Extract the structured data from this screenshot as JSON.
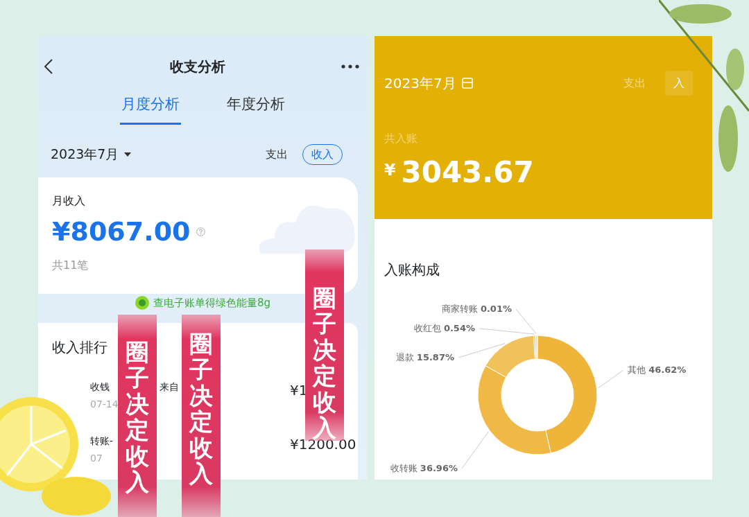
{
  "left_screen": {
    "title": "收支分析",
    "tabs": [
      {
        "label": "月度分析",
        "selected": true
      },
      {
        "label": "年度分析",
        "selected": false
      }
    ],
    "month": "2023年7月",
    "type_toggle": [
      {
        "label": "支出",
        "selected": false
      },
      {
        "label": "收入",
        "selected": true
      }
    ],
    "summary": {
      "label": "月收入",
      "amount": "¥8067.00",
      "count": "共11笔"
    },
    "energy_tip": "查电子账单得绿色能量8g",
    "ranking": {
      "title": "收入排行",
      "rows": [
        {
          "title_parts": [
            "收钱",
            "来自"
          ],
          "date": "07-14",
          "amount_parts": [
            "¥1"
          ]
        },
        {
          "title_parts": [
            "转账-"
          ],
          "date": "07",
          "amount_parts": [
            "¥1200.00"
          ]
        }
      ]
    }
  },
  "right_screen": {
    "month": "2023年7月",
    "type_toggle": [
      {
        "label": "支出",
        "selected": false
      },
      {
        "label": "入",
        "selected": true
      }
    ],
    "total_label": "共入账",
    "currency": "¥",
    "total": "3043.67",
    "composition": {
      "title": "入账构成",
      "chart_data": {
        "type": "donut",
        "categories": [
          "其他",
          "收转账",
          "退款",
          "收红包",
          "商家转账"
        ],
        "values": [
          46.62,
          36.96,
          15.87,
          0.54,
          0.01
        ],
        "value_labels": [
          "46.62%",
          "36.96%",
          "15.87%",
          "0.54%",
          "0.01%"
        ]
      }
    }
  },
  "banners": [
    {
      "text": "圈子决定收入"
    },
    {
      "text": "圈子决定收入"
    },
    {
      "text": "圈子决定收入"
    }
  ]
}
